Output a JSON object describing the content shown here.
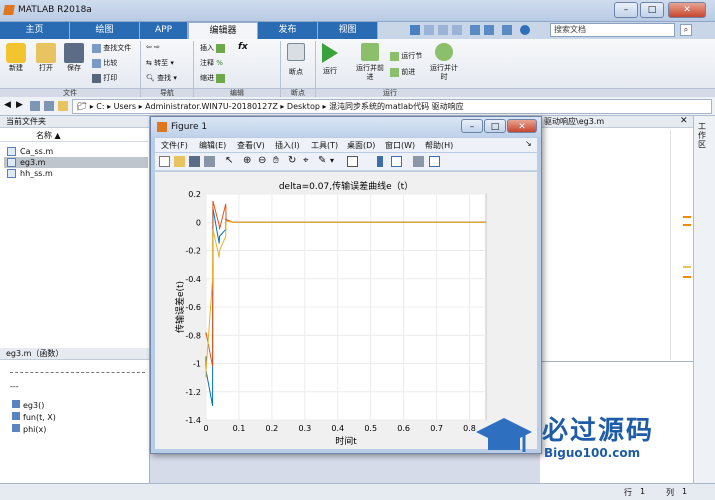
{
  "window": {
    "title": "MATLAB R2018a",
    "search_placeholder": "搜索文档"
  },
  "tabs": [
    "主页",
    "绘图",
    "APP",
    "编辑器",
    "发布",
    "视图"
  ],
  "ribbon": {
    "file_group": "文件",
    "new": "新建",
    "open": "打开",
    "save": "保存",
    "find_files": "查找文件",
    "compare": "比较",
    "print": "打印",
    "nav_group": "导航",
    "goto": "转至",
    "find": "查找",
    "edit_group": "编辑",
    "insert": "插入",
    "comment": "注释",
    "indent": "缩进",
    "fx": "fx",
    "bp_group": "断点",
    "breakpoint": "断点",
    "run_group": "运行",
    "run": "运行",
    "run_advance": "运行并前进",
    "run_section": "运行节",
    "advance": "前进",
    "run_time": "运行并计时"
  },
  "address": [
    "C:",
    "Users",
    "Administrator.WIN7U-20180127Z",
    "Desktop",
    "混沌同步系统的matlab代码 驱动响应"
  ],
  "current_folder": {
    "title": "当前文件夹",
    "col_name": "名称",
    "files": [
      "Ca_ss.m",
      "eg3.m",
      "hh_ss.m"
    ]
  },
  "details": {
    "title": "eg3.m（函数）",
    "separator": "---",
    "items": [
      "eg3()",
      "fun(t, X)",
      "phi(x)"
    ]
  },
  "editor_tab": "驱动响应\\eg3.m",
  "side_label": "工作区",
  "status": {
    "row_label": "行",
    "row": "1",
    "col_label": "列",
    "col": "1"
  },
  "figure": {
    "title": "Figure 1",
    "menu": [
      "文件(F)",
      "编辑(E)",
      "查看(V)",
      "插入(I)",
      "工具(T)",
      "桌面(D)",
      "窗口(W)",
      "帮助(H)"
    ]
  },
  "chart_data": {
    "type": "line",
    "title": "delta=0.07,传输误差曲线e（t）",
    "xlabel": "时间t",
    "ylabel": "传输误差e(t)",
    "xlim": [
      0,
      0.85
    ],
    "ylim": [
      -1.4,
      0.2
    ],
    "xticks": [
      0,
      0.1,
      0.2,
      0.3,
      0.4,
      0.5,
      0.6,
      0.7,
      0.8
    ],
    "yticks": [
      0.2,
      0,
      -0.2,
      -0.4,
      -0.6,
      -0.8,
      -1,
      -1.2,
      -1.4
    ],
    "series": [
      {
        "color": "#0072bd",
        "x": [
          0,
          0.0001,
          0.02,
          0.021,
          0.04,
          0.041,
          0.06,
          0.0601,
          0.08,
          0.1,
          0.2,
          0.85
        ],
        "y": [
          -0.95,
          -1.05,
          -1.3,
          0.1,
          -0.15,
          -0.1,
          -0.05,
          0.02,
          0.0,
          0.0,
          0.0,
          0.0
        ]
      },
      {
        "color": "#d95319",
        "x": [
          0,
          0.0001,
          0.02,
          0.021,
          0.04,
          0.041,
          0.06,
          0.061,
          0.08,
          0.1,
          0.2,
          0.85
        ],
        "y": [
          -0.8,
          -0.78,
          -1.02,
          0.15,
          -0.02,
          -0.05,
          0.13,
          0.02,
          0.0,
          0.0,
          0.0,
          0.0
        ]
      },
      {
        "color": "#edb120",
        "x": [
          0,
          0.0001,
          0.02,
          0.021,
          0.04,
          0.041,
          0.06,
          0.061,
          0.08,
          0.1,
          0.2,
          0.85
        ],
        "y": [
          -1.1,
          -1.05,
          -0.4,
          -0.05,
          -0.25,
          -0.2,
          -0.1,
          0.01,
          0.0,
          0.0,
          0.0,
          0.0
        ]
      }
    ]
  },
  "watermark": {
    "brand": "必过源码",
    "url": "Biguo100.com"
  }
}
